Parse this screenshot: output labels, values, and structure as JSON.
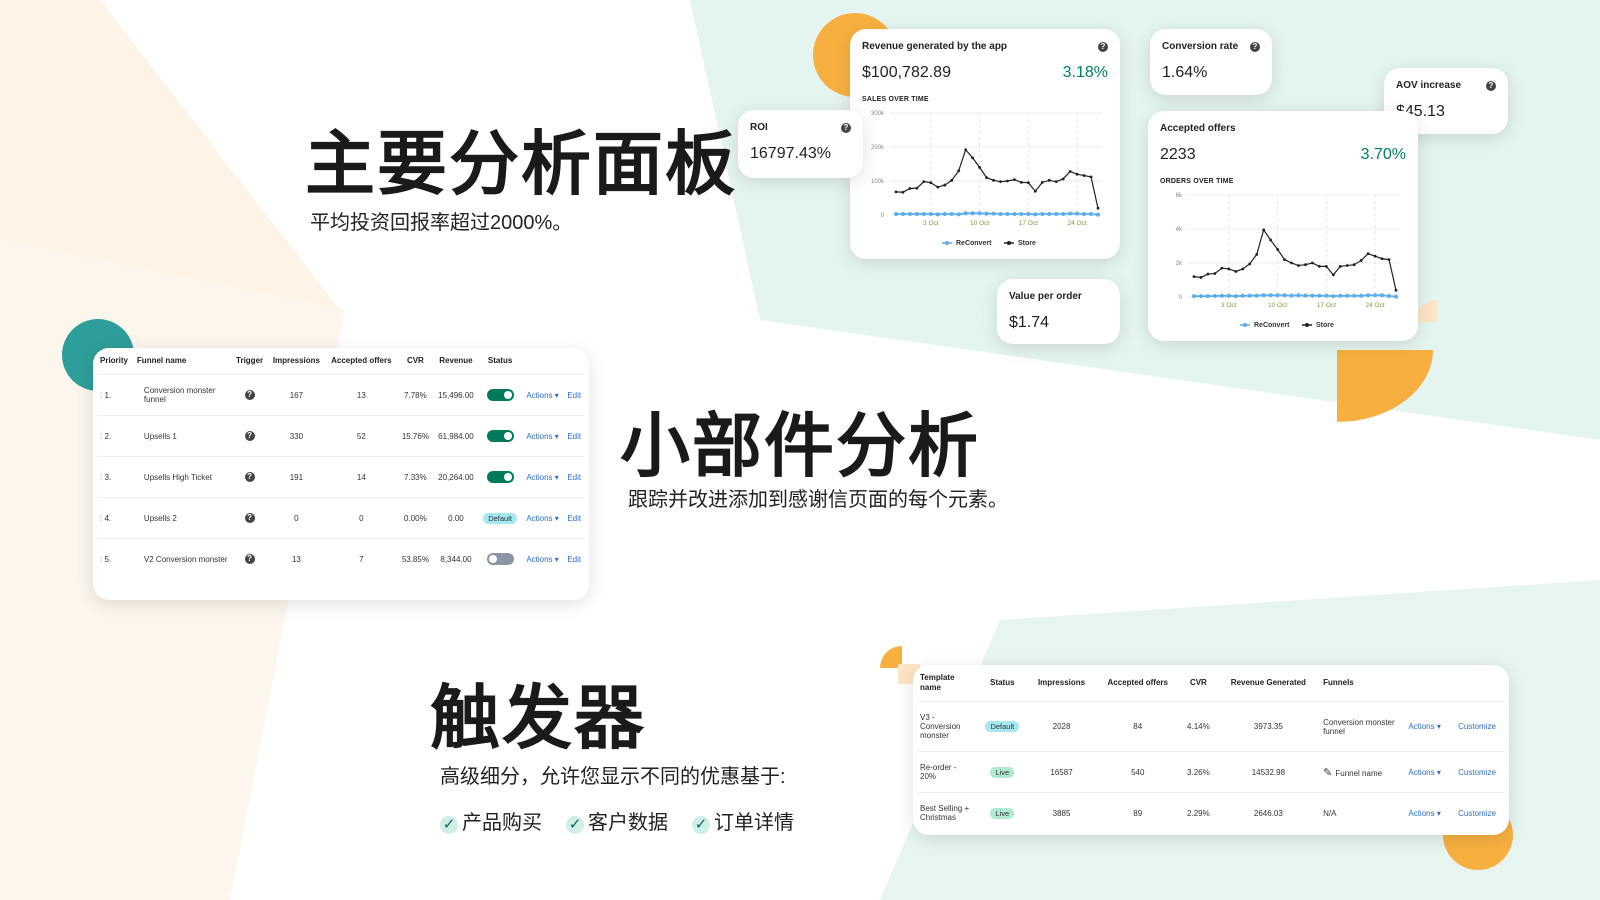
{
  "colors": {
    "orange": "#f7b040",
    "teal": "#2e9e9a",
    "mint": "#dff3ee",
    "cream": "#fdf3e6",
    "green": "#008060",
    "blue_series": "#5aaeed",
    "store_series": "#222222",
    "link": "#2c6ecb"
  },
  "sections": [
    {
      "title": "主要分析面板",
      "subtitle": "平均投资回报率超过2000%。"
    },
    {
      "title": "小部件分析",
      "subtitle": "跟踪并改进添加到感谢信页面的每个元素。"
    },
    {
      "title": "触发器",
      "subtitle": "高级细分，允许您显示不同的优惠基于:",
      "checks": [
        "产品购买",
        "客户数据",
        "订单详情"
      ]
    }
  ],
  "cards": {
    "revenue": {
      "title": "Revenue generated by the app",
      "value": "$100,782.89",
      "change": "3.18%",
      "chart_title": "SALES OVER TIME"
    },
    "roi": {
      "title": "ROI",
      "value": "16797.43%"
    },
    "conversion": {
      "title": "Conversion rate",
      "value": "1.64%"
    },
    "aov": {
      "title": "AOV increase",
      "value": "$45.13"
    },
    "accepted": {
      "title": "Accepted offers",
      "value": "2233",
      "change": "3.70%",
      "chart_title": "ORDERS OVER TIME"
    },
    "vpo": {
      "title": "Value per order",
      "value": "$1.74"
    }
  },
  "chart_data": [
    {
      "type": "line",
      "title": "SALES OVER TIME",
      "x_ticks": [
        "3 Oct",
        "10 Oct",
        "17 Oct",
        "24 Oct"
      ],
      "y_ticks": [
        "0",
        "100k",
        "200k",
        "300k"
      ],
      "ylim": [
        0,
        300
      ],
      "grid": true,
      "legend": "bottom",
      "series": [
        {
          "name": "ReConvert",
          "values": [
            3,
            3,
            3,
            3,
            3,
            3,
            2,
            3,
            3,
            2,
            5,
            5,
            5,
            4,
            4,
            3,
            3,
            3,
            3,
            3,
            2,
            3,
            3,
            3,
            3,
            4,
            4,
            3,
            3,
            1
          ]
        },
        {
          "name": "Store",
          "values": [
            68,
            67,
            78,
            79,
            98,
            95,
            82,
            88,
            102,
            130,
            192,
            168,
            140,
            110,
            102,
            98,
            100,
            104,
            96,
            95,
            70,
            96,
            102,
            98,
            106,
            128,
            120,
            116,
            112,
            20
          ]
        }
      ]
    },
    {
      "type": "line",
      "title": "ORDERS OVER TIME",
      "x_ticks": [
        "3 Oct",
        "10 Oct",
        "17 Oct",
        "24 Oct"
      ],
      "y_ticks": [
        "0",
        "2k",
        "4k",
        "6k"
      ],
      "ylim": [
        0,
        6
      ],
      "grid": true,
      "legend": "bottom",
      "series": [
        {
          "name": "ReConvert",
          "values": [
            0.05,
            0.05,
            0.05,
            0.06,
            0.07,
            0.07,
            0.05,
            0.07,
            0.08,
            0.08,
            0.1,
            0.1,
            0.1,
            0.1,
            0.08,
            0.1,
            0.08,
            0.08,
            0.07,
            0.07,
            0.05,
            0.07,
            0.07,
            0.07,
            0.07,
            0.1,
            0.1,
            0.1,
            0.06,
            0.02
          ]
        },
        {
          "name": "Store",
          "values": [
            1.2,
            1.15,
            1.35,
            1.38,
            1.7,
            1.65,
            1.5,
            1.65,
            1.95,
            2.5,
            3.95,
            3.35,
            2.8,
            2.2,
            2.0,
            1.85,
            1.9,
            2.0,
            1.8,
            1.8,
            1.3,
            1.8,
            1.85,
            1.9,
            2.15,
            2.55,
            2.4,
            2.25,
            2.2,
            0.4
          ]
        }
      ]
    }
  ],
  "funnels": {
    "headers": [
      "Priority",
      "Funnel name",
      "Trigger",
      "Impressions",
      "Accepted offers",
      "CVR",
      "Revenue",
      "Status",
      "",
      ""
    ],
    "rows": [
      {
        "priority": "1.",
        "name": "Conversion monster funnel",
        "impressions": "167",
        "accepted": "13",
        "cvr": "7.78%",
        "revenue": "15,496.00",
        "status": "on",
        "actions": "Actions",
        "edit": "Edit"
      },
      {
        "priority": "2.",
        "name": "Upsells 1",
        "impressions": "330",
        "accepted": "52",
        "cvr": "15.76%",
        "revenue": "61,984.00",
        "status": "on",
        "actions": "Actions",
        "edit": "Edit"
      },
      {
        "priority": "3.",
        "name": "Upsells High Ticket",
        "impressions": "191",
        "accepted": "14",
        "cvr": "7.33%",
        "revenue": "20,264.00",
        "status": "on",
        "actions": "Actions",
        "edit": "Edit"
      },
      {
        "priority": "4.",
        "name": "Upsells 2",
        "impressions": "0",
        "accepted": "0",
        "cvr": "0.00%",
        "revenue": "0.00",
        "status": "Default",
        "actions": "Actions",
        "edit": "Edit"
      },
      {
        "priority": "5.",
        "name": "V2 Conversion monster",
        "impressions": "13",
        "accepted": "7",
        "cvr": "53.85%",
        "revenue": "8,344.00",
        "status": "off",
        "actions": "Actions",
        "edit": "Edit"
      }
    ]
  },
  "templates": {
    "headers": [
      "Template name",
      "Status",
      "Impressions",
      "Accepted offers",
      "CVR",
      "Revenue Generated",
      "Funnels",
      "",
      ""
    ],
    "rows": [
      {
        "name": "V3 - Conversion monster",
        "status": "Default",
        "impressions": "2028",
        "accepted": "84",
        "cvr": "4.14%",
        "revenue": "3973.35",
        "funnels": "Conversion monster funnel",
        "actions": "Actions",
        "customize": "Customize"
      },
      {
        "name": "Re-order - 20%",
        "status": "Live",
        "impressions": "16587",
        "accepted": "540",
        "cvr": "3.26%",
        "revenue": "14532.98",
        "funnels": "Funnel name",
        "pencil": true,
        "actions": "Actions",
        "customize": "Customize"
      },
      {
        "name": "Best Selling + Christmas",
        "status": "Live",
        "impressions": "3885",
        "accepted": "89",
        "cvr": "2.29%",
        "revenue": "2646.03",
        "funnels": "N/A",
        "actions": "Actions",
        "customize": "Customize"
      }
    ]
  }
}
